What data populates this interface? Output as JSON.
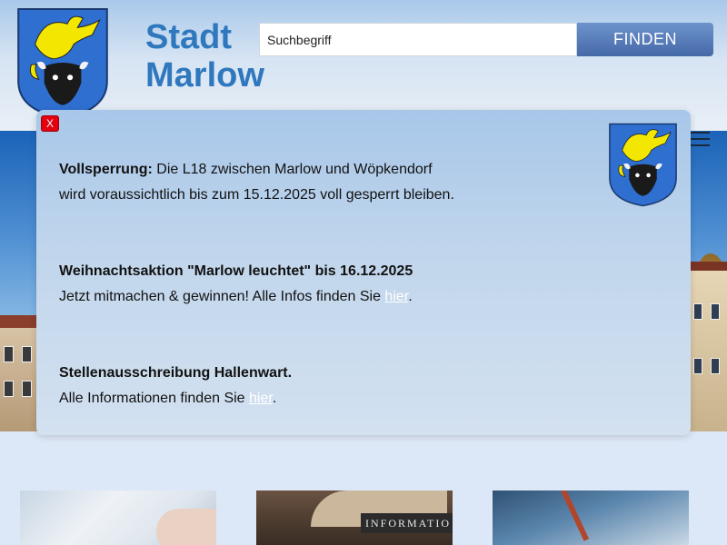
{
  "header": {
    "title_line1": "Stadt",
    "title_line2": "Marlow",
    "search": {
      "placeholder": "Suchbegriff",
      "button_label": "FINDEN"
    }
  },
  "notice_modal": {
    "close_label": "X",
    "notices": [
      {
        "heading": "Vollsperrung:",
        "line1_rest": " Die L18 zwischen Marlow und Wöpkendorf",
        "line2": "wird voraussichtlich bis zum 15.12.2025 voll gesperrt bleiben."
      },
      {
        "heading": "Weihnachtsaktion \"Marlow leuchtet\" bis 16.12.2025",
        "line2_before": "Jetzt mitmachen & gewinnen! Alle Infos finden Sie ",
        "link": "hier",
        "line2_after": "."
      },
      {
        "heading": "Stellenausschreibung Hallenwart.",
        "line2_before": "Alle Informationen finden Sie ",
        "link": "hier",
        "line2_after": "."
      }
    ]
  },
  "cards": [
    {
      "image": "hand-typing-photo"
    },
    {
      "image": "information-desk-photo",
      "sign_text": "INFORMATIO"
    },
    {
      "image": "pen-writing-photo"
    }
  ],
  "icons": {
    "coat_of_arms": "coat-of-arms-icon",
    "menu": "hamburger-menu-icon"
  },
  "colors": {
    "title": "#2f78bd",
    "button": "#5579b8",
    "close": "#e3000f",
    "link": "#ffffff"
  }
}
